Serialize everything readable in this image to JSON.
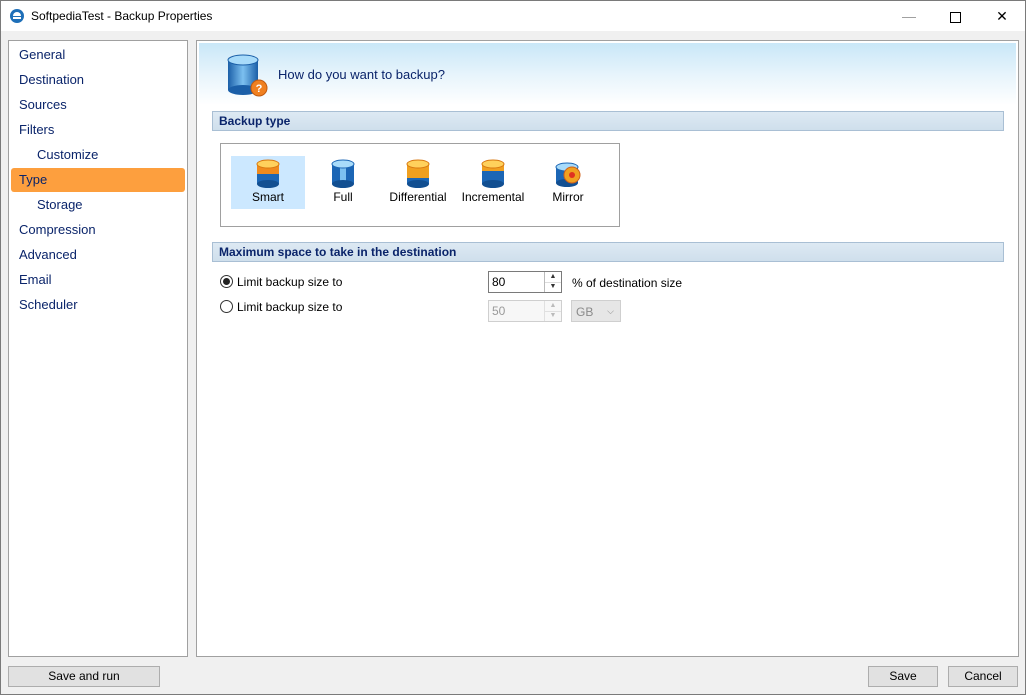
{
  "window": {
    "title": "SoftpediaTest - Backup Properties"
  },
  "sidebar": {
    "items": [
      {
        "label": "General"
      },
      {
        "label": "Destination"
      },
      {
        "label": "Sources"
      },
      {
        "label": "Filters"
      },
      {
        "label": "Customize"
      },
      {
        "label": "Type"
      },
      {
        "label": "Storage"
      },
      {
        "label": "Compression"
      },
      {
        "label": "Advanced"
      },
      {
        "label": "Email"
      },
      {
        "label": "Scheduler"
      }
    ],
    "selected": "Type"
  },
  "header": {
    "question": "How do you want to backup?"
  },
  "backup_type": {
    "section_title": "Backup type",
    "options": [
      {
        "label": "Smart",
        "icon": "smart-backup-icon"
      },
      {
        "label": "Full",
        "icon": "full-backup-icon"
      },
      {
        "label": "Differential",
        "icon": "differential-backup-icon"
      },
      {
        "label": "Incremental",
        "icon": "incremental-backup-icon"
      },
      {
        "label": "Mirror",
        "icon": "mirror-backup-icon"
      }
    ],
    "selected": "Smart"
  },
  "max_space": {
    "section_title": "Maximum space to take in the destination",
    "option1": {
      "label": "Limit backup size to",
      "value": "80",
      "unit": "% of destination size",
      "checked": true
    },
    "option2": {
      "label": "Limit backup size to",
      "value": "50",
      "unit": "GB",
      "checked": false
    }
  },
  "footer": {
    "save_and_run": "Save and run",
    "save": "Save",
    "cancel": "Cancel"
  },
  "colors": {
    "selected_nav": "#fd9f3e",
    "accent_text": "#0a246a",
    "selected_type_bg": "#cce8ff"
  }
}
